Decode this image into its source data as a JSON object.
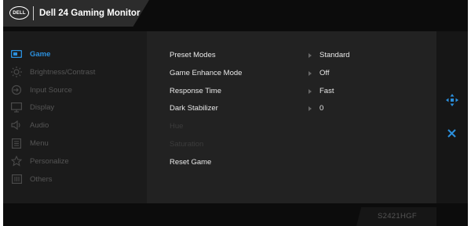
{
  "header": {
    "logo_text": "DELL",
    "title": "Dell 24 Gaming Monitor"
  },
  "menu": [
    {
      "label": "Game",
      "icon": "game-icon",
      "active": true
    },
    {
      "label": "Brightness/Contrast",
      "icon": "brightness-icon"
    },
    {
      "label": "Input Source",
      "icon": "input-source-icon"
    },
    {
      "label": "Display",
      "icon": "display-icon"
    },
    {
      "label": "Audio",
      "icon": "audio-icon"
    },
    {
      "label": "Menu",
      "icon": "menu-icon"
    },
    {
      "label": "Personalize",
      "icon": "star-icon"
    },
    {
      "label": "Others",
      "icon": "others-icon"
    }
  ],
  "options": [
    {
      "label": "Preset Modes",
      "value": "Standard"
    },
    {
      "label": "Game Enhance Mode",
      "value": "Off"
    },
    {
      "label": "Response Time",
      "value": "Fast"
    },
    {
      "label": "Dark Stabilizer",
      "value": "0"
    },
    {
      "label": "Hue",
      "value": ""
    },
    {
      "label": "Saturation",
      "value": ""
    },
    {
      "label": "Reset Game",
      "value": ""
    }
  ],
  "footer": {
    "model": "S2421HGF"
  },
  "colors": {
    "accent": "#2b8fdc",
    "background": "#0c0c0c",
    "panel": "#222222"
  }
}
